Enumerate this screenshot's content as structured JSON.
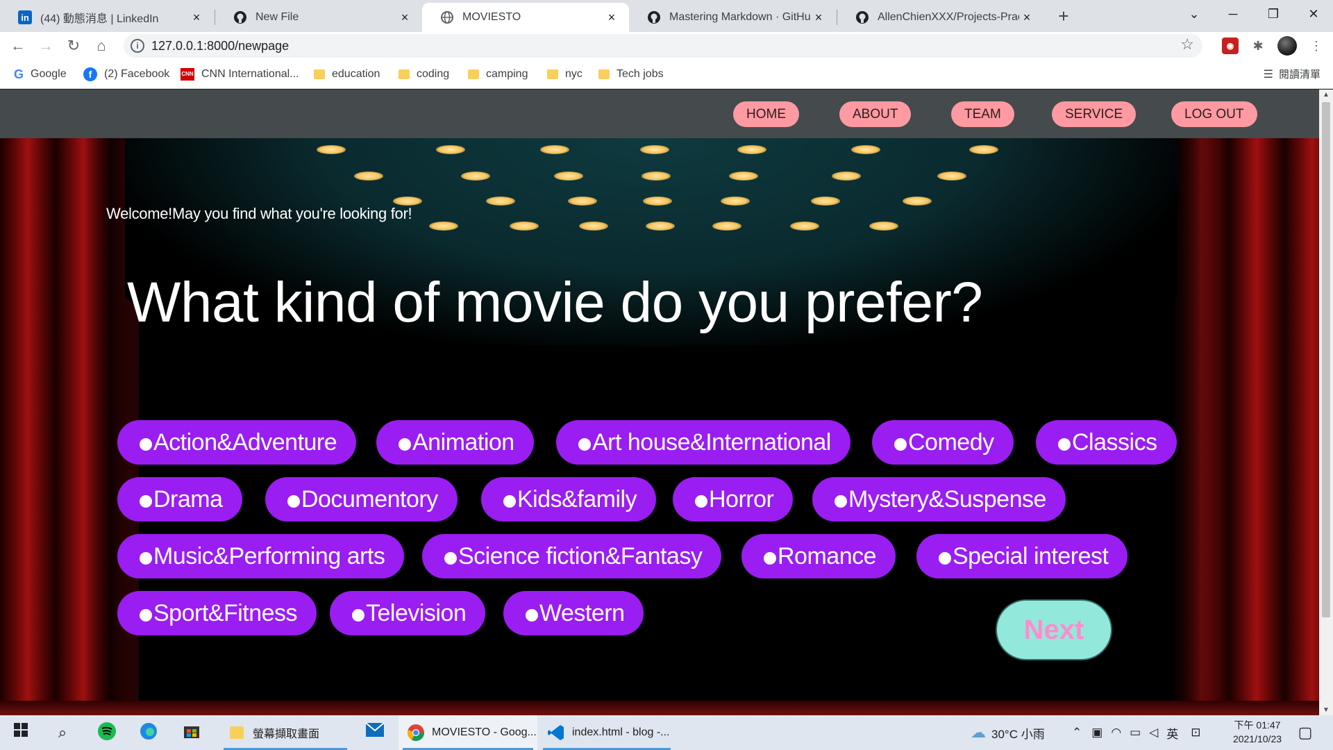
{
  "browser": {
    "tabs": [
      {
        "title": "(44) 動態消息 | LinkedIn",
        "icon": "linkedin-icon",
        "active": false
      },
      {
        "title": "New File",
        "icon": "github-icon",
        "active": false
      },
      {
        "title": "MOVIESTO",
        "icon": "globe-icon",
        "active": true
      },
      {
        "title": "Mastering Markdown · GitHub",
        "icon": "github-icon",
        "active": false
      },
      {
        "title": "AllenChienXXX/Projects-Practic",
        "icon": "github-icon",
        "active": false
      }
    ],
    "close_glyph": "×",
    "new_tab_glyph": "+",
    "url": "127.0.0.1:8000/newpage",
    "info_glyph": "i",
    "bookmarks": [
      {
        "label": "Google",
        "icon": "google-icon"
      },
      {
        "label": "(2) Facebook",
        "icon": "facebook-icon"
      },
      {
        "label": "CNN International...",
        "icon": "cnn-icon"
      },
      {
        "label": "education",
        "icon": "folder-icon"
      },
      {
        "label": "coding",
        "icon": "folder-icon"
      },
      {
        "label": "camping",
        "icon": "folder-icon"
      },
      {
        "label": "nyc",
        "icon": "folder-icon"
      },
      {
        "label": "Tech jobs",
        "icon": "folder-icon"
      }
    ],
    "reading_list": "閱讀清單",
    "google_glyph": "G",
    "facebook_glyph": "f",
    "cnn_glyph": "CNN",
    "linkedin_glyph": "in"
  },
  "site": {
    "nav": [
      "HOME",
      "ABOUT",
      "TEAM",
      "SERVICE",
      "LOG OUT"
    ],
    "welcome": "Welcome!May you find what you're looking for!",
    "question": "What kind of movie do you prefer?",
    "genres": [
      "Action&Adventure",
      "Animation",
      "Art house&International",
      "Comedy",
      "Classics",
      "Drama",
      "Documentory",
      "Kids&family",
      "Horror",
      "Mystery&Suspense",
      "Music&Performing arts",
      "Science fiction&Fantasy",
      "Romance",
      "Special interest",
      "Sport&Fitness",
      "Television",
      "Western"
    ],
    "next": "Next"
  },
  "taskbar": {
    "apps": [
      {
        "label": "螢幕擷取畫面",
        "icon": "file-explorer-icon"
      },
      {
        "label": "MOVIESTO - Goog...",
        "icon": "chrome-icon"
      },
      {
        "label": "index.html - blog -...",
        "icon": "vscode-icon"
      }
    ],
    "weather": "30°C  小雨",
    "ime": "英",
    "time": "下午 01:47",
    "date": "2021/10/23"
  },
  "colors": {
    "nav_bg": "#454a4c",
    "nav_button": "#ff9aa2",
    "genre_button": "#9a1df2",
    "next_button": "#93e8dc",
    "next_text": "#ff8ccf"
  }
}
